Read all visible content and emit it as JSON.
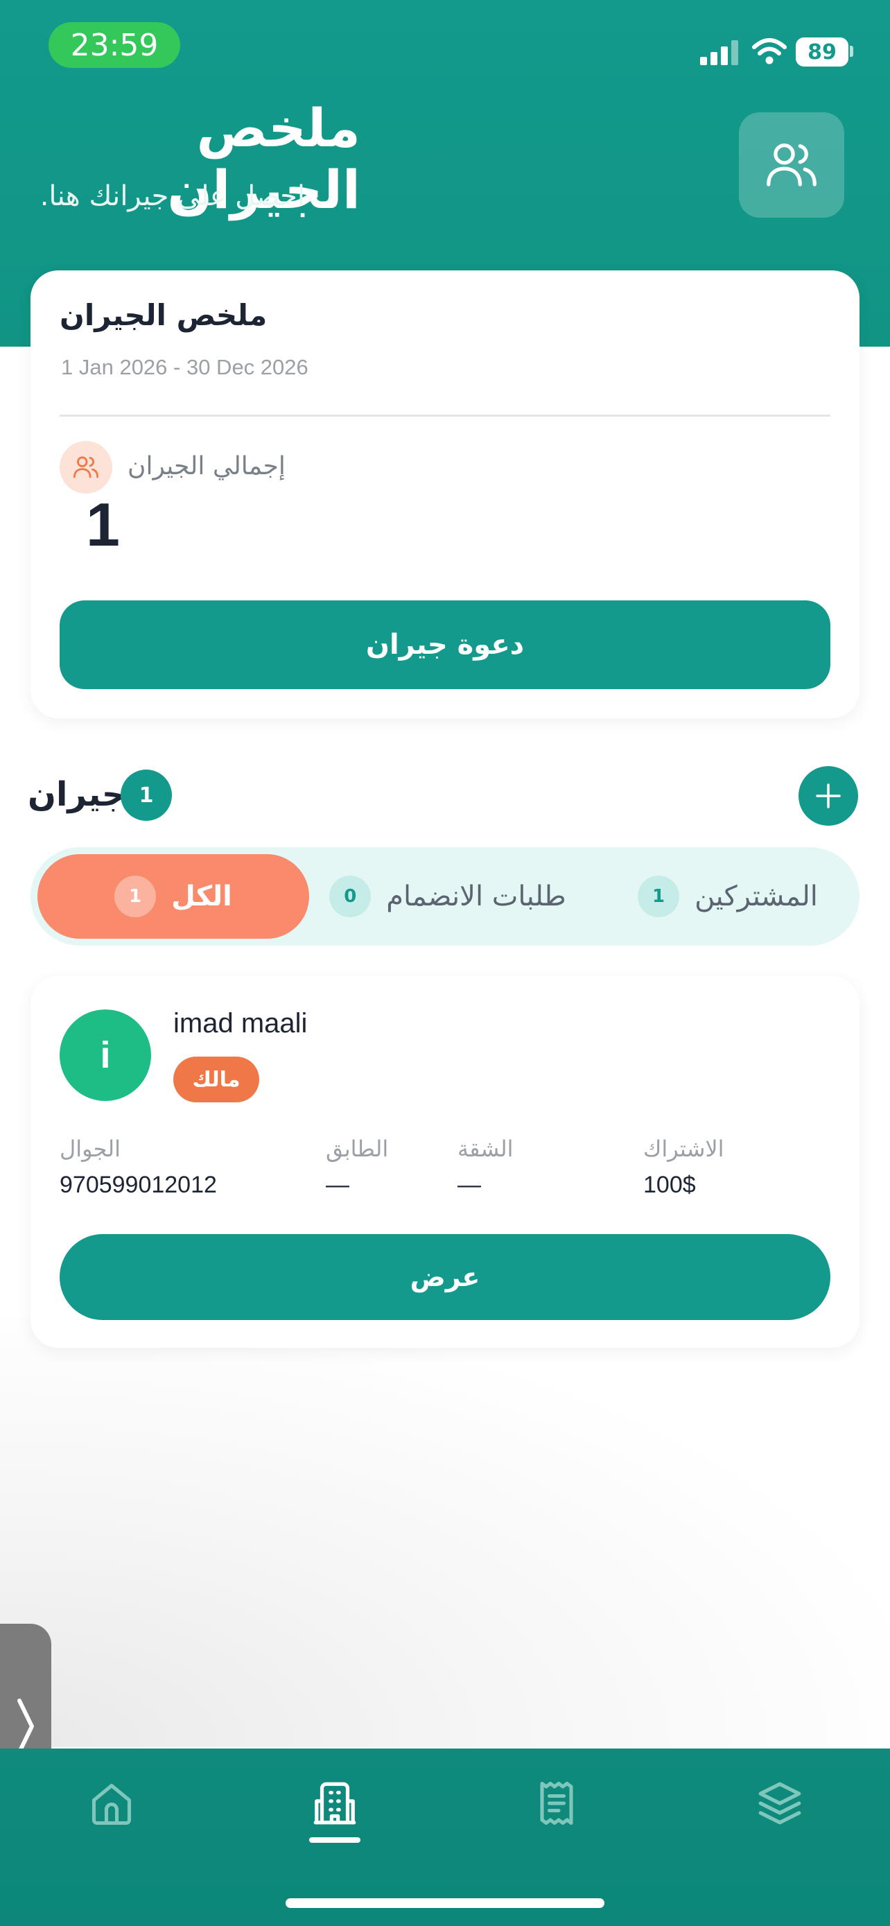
{
  "status_bar": {
    "time": "23:59",
    "battery": "89"
  },
  "header": {
    "title": "ملخص الجيران",
    "subtitle": "احصل على جيرانك هنا."
  },
  "summary": {
    "title": "ملخص الجيران",
    "date_range": "1 Jan 2026 - 30 Dec 2026",
    "total_label": "إجمالي الجيران",
    "total_value": "1",
    "invite_label": "دعوة جيران"
  },
  "neighbors_section": {
    "title": "جيران",
    "count": "1"
  },
  "tabs": [
    {
      "label": "الكل",
      "count": "1",
      "active": true
    },
    {
      "label": "طلبات الانضمام",
      "count": "0",
      "active": false
    },
    {
      "label": "المشتركين",
      "count": "1",
      "active": false
    }
  ],
  "neighbor": {
    "initial": "i",
    "name": "imad maali",
    "role": "مالك",
    "fields": [
      {
        "label": "الجوال",
        "value": "970599012012"
      },
      {
        "label": "الطابق",
        "value": "—"
      },
      {
        "label": "الشقة",
        "value": "—"
      },
      {
        "label": "الاشتراك",
        "value": "100$"
      }
    ],
    "view_label": "عرض"
  },
  "bottom_nav": [
    {
      "icon": "home-icon",
      "active": false
    },
    {
      "icon": "building-icon",
      "active": true
    },
    {
      "icon": "receipt-icon",
      "active": false
    },
    {
      "icon": "layers-icon",
      "active": false
    }
  ],
  "colors": {
    "primary": "#139a8c",
    "accent": "#f98a6c",
    "owner_badge": "#f07848",
    "avatar": "#1ebd85",
    "status_pill": "#34c759"
  }
}
